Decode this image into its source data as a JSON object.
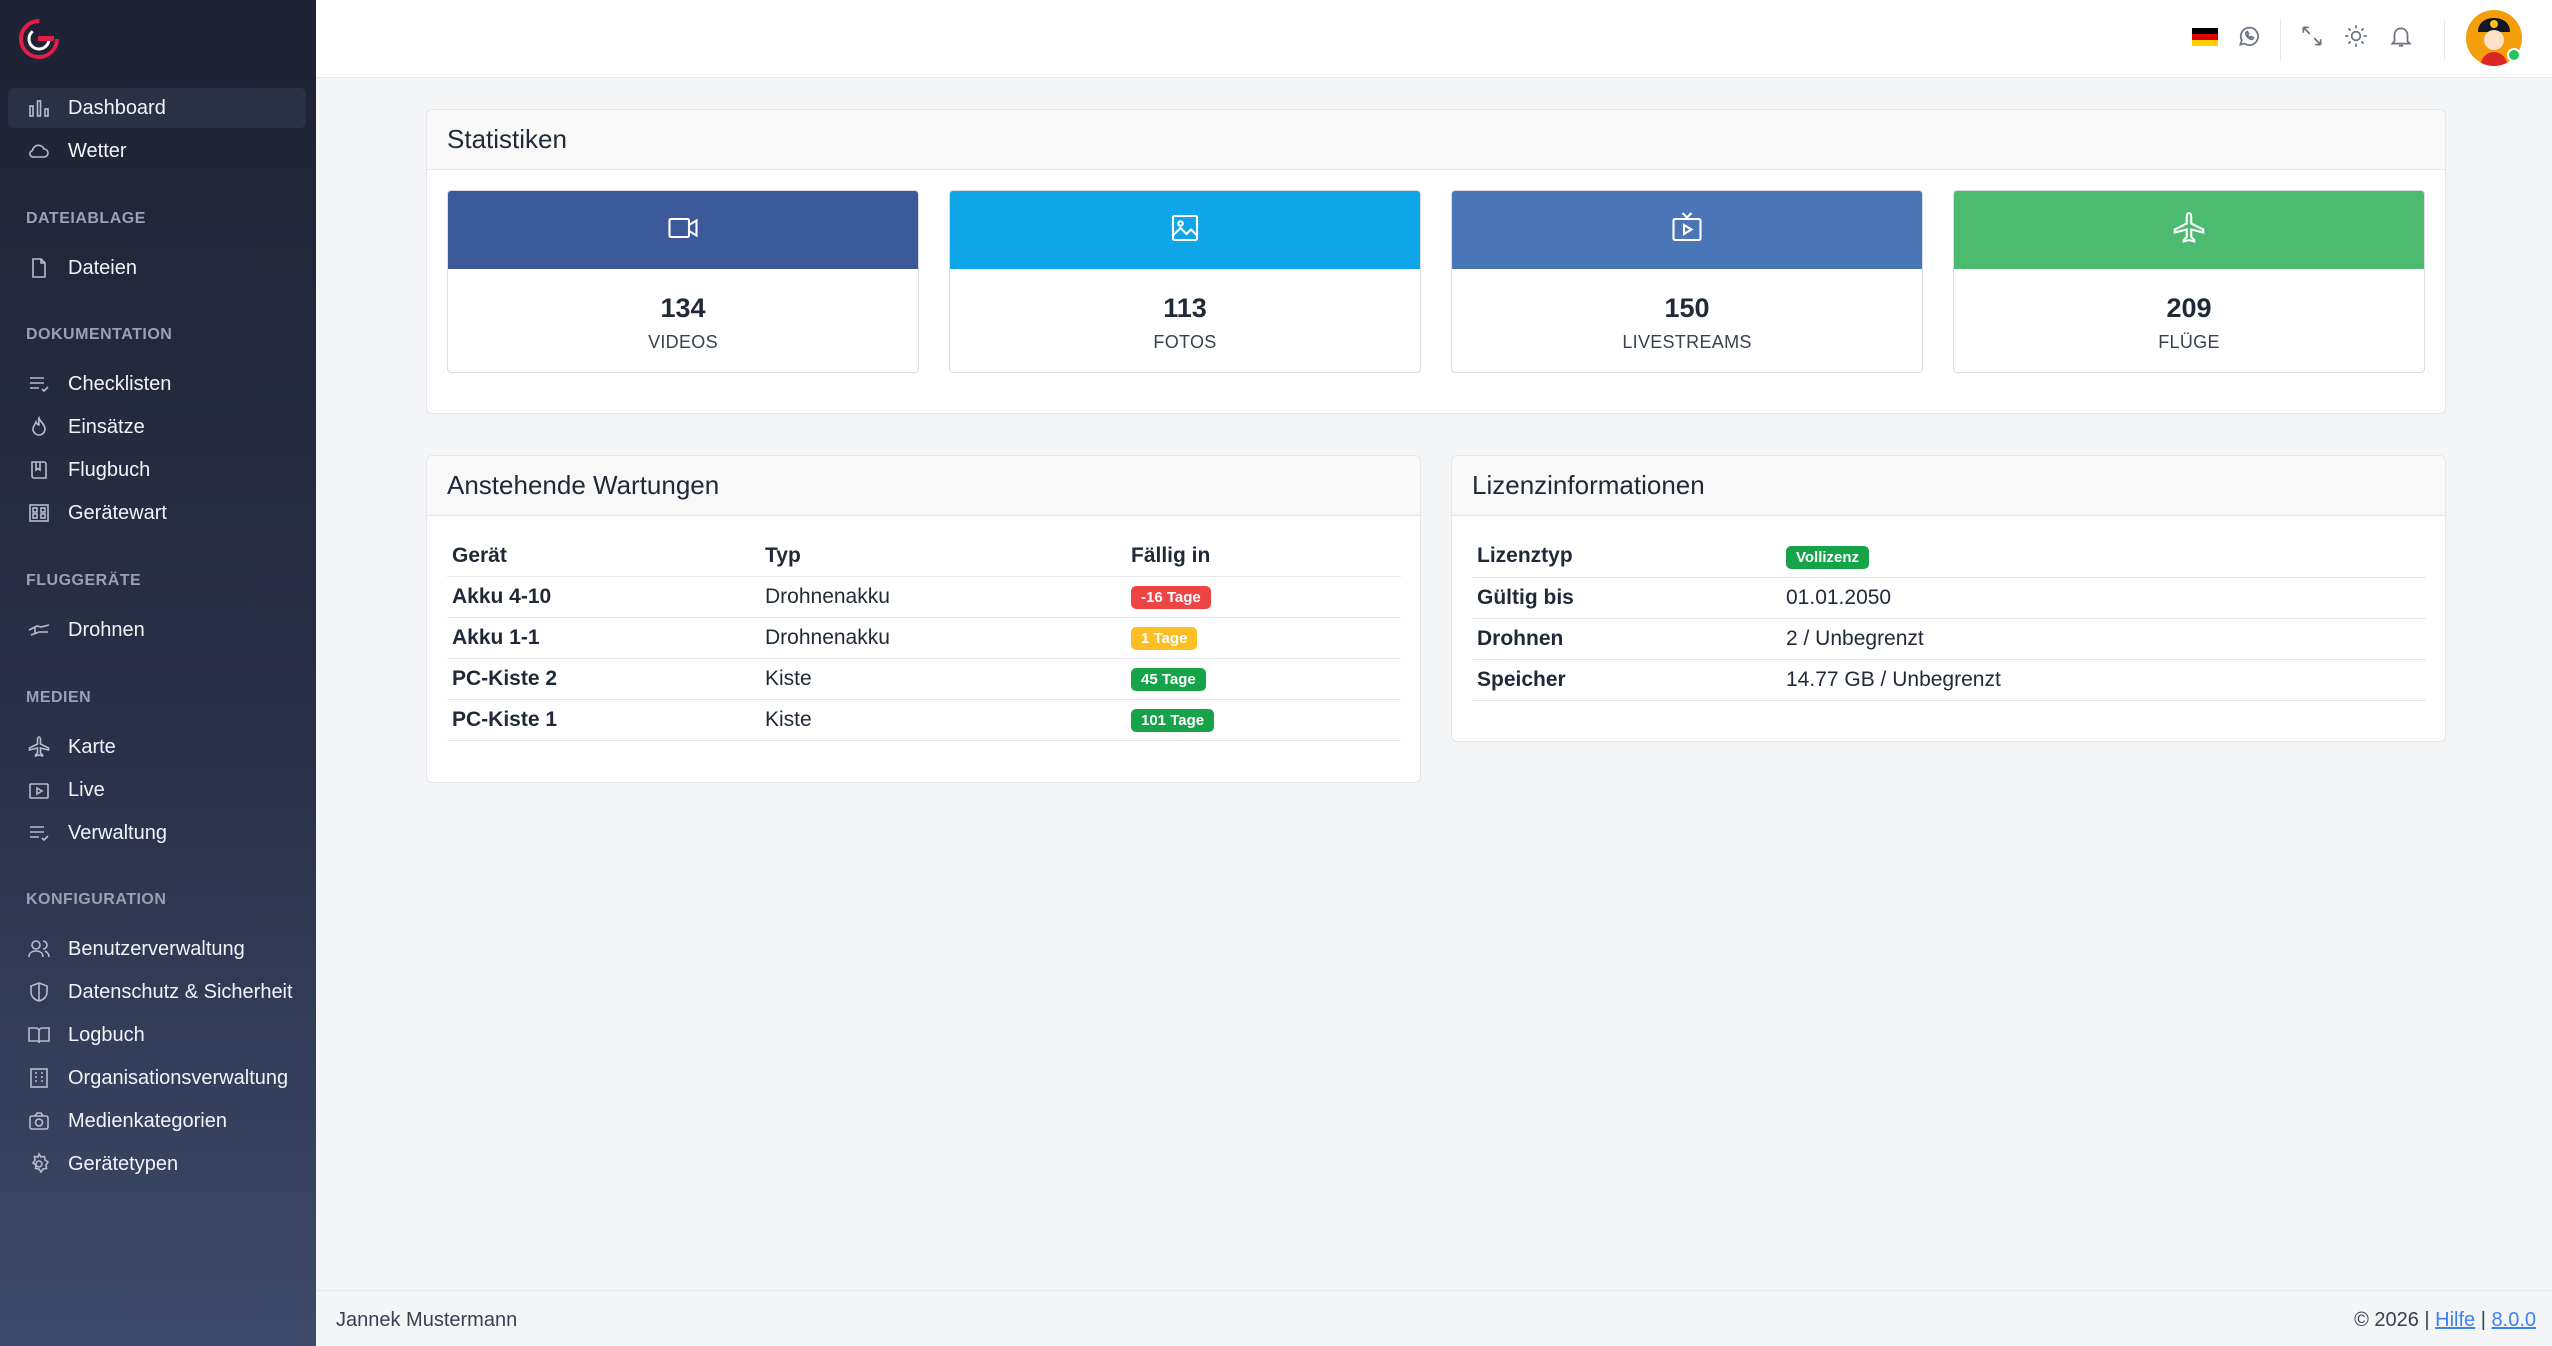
{
  "sidebar": {
    "items": {
      "dashboard": {
        "label": "Dashboard",
        "icon": "bar-chart-icon"
      },
      "wetter": {
        "label": "Wetter",
        "icon": "cloud-icon"
      },
      "dateien": {
        "label": "Dateien",
        "icon": "file-icon"
      },
      "checklisten": {
        "label": "Checklisten",
        "icon": "list-icon"
      },
      "einsaetze": {
        "label": "Einsätze",
        "icon": "flame-icon"
      },
      "flugbuch": {
        "label": "Flugbuch",
        "icon": "book-icon"
      },
      "geraetewart": {
        "label": "Gerätewart",
        "icon": "grid-icon"
      },
      "drohnen": {
        "label": "Drohnen",
        "icon": "drone-icon"
      },
      "karte": {
        "label": "Karte",
        "icon": "plane-icon"
      },
      "live": {
        "label": "Live",
        "icon": "live-tv-icon"
      },
      "verwaltung": {
        "label": "Verwaltung",
        "icon": "list-icon"
      },
      "benutzer": {
        "label": "Benutzerverwaltung",
        "icon": "users-icon"
      },
      "datenschutz": {
        "label": "Datenschutz & Sicherheit",
        "icon": "shield-icon"
      },
      "logbuch": {
        "label": "Logbuch",
        "icon": "open-book-icon"
      },
      "organisation": {
        "label": "Organisationsverwaltung",
        "icon": "building-icon"
      },
      "medienkategorien": {
        "label": "Medienkategorien",
        "icon": "camera-icon"
      },
      "geraetetypen": {
        "label": "Gerätetypen",
        "icon": "gear-icon"
      }
    },
    "sections": {
      "dateiablage": "DATEIABLAGE",
      "dokumentation": "DOKUMENTATION",
      "fluggeraete": "FLUGGERÄTE",
      "medien": "MEDIEN",
      "konfiguration": "KONFIGURATION"
    }
  },
  "statistiken": {
    "title": "Statistiken",
    "cards": [
      {
        "value": "134",
        "label": "VIDEOS",
        "color": "#3b5998",
        "icon": "video-camera-icon"
      },
      {
        "value": "113",
        "label": "FOTOS",
        "color": "#0ea5e9",
        "icon": "image-icon"
      },
      {
        "value": "150",
        "label": "LIVESTREAMS",
        "color": "#4a76b8",
        "icon": "live-tv-icon"
      },
      {
        "value": "209",
        "label": "FLÜGE",
        "color": "#4cbb70",
        "icon": "plane-icon"
      }
    ]
  },
  "wartungen": {
    "title": "Anstehende Wartungen",
    "headers": [
      "Gerät",
      "Typ",
      "Fällig in"
    ],
    "rows": [
      {
        "geraet": "Akku 4-10",
        "typ": "Drohnenakku",
        "faellig": "-16 Tage",
        "color": "#ef4444"
      },
      {
        "geraet": "Akku 1-1",
        "typ": "Drohnenakku",
        "faellig": "1 Tage",
        "color": "#fbbf24"
      },
      {
        "geraet": "PC-Kiste 2",
        "typ": "Kiste",
        "faellig": "45 Tage",
        "color": "#16a34a"
      },
      {
        "geraet": "PC-Kiste 1",
        "typ": "Kiste",
        "faellig": "101 Tage",
        "color": "#16a34a"
      }
    ]
  },
  "lizenz": {
    "title": "Lizenzinformationen",
    "rows": [
      {
        "label": "Lizenztyp",
        "value": "Vollizenz",
        "badge": true,
        "color": "#16a34a"
      },
      {
        "label": "Gültig bis",
        "value": "01.01.2050"
      },
      {
        "label": "Drohnen",
        "value": "2 / Unbegrenzt"
      },
      {
        "label": "Speicher",
        "value": "14.77 GB / Unbegrenzt"
      }
    ]
  },
  "footer": {
    "user": "Jannek Mustermann",
    "copyright": "© 2026 |",
    "help": "Hilfe",
    "separator": "|",
    "version": "8.0.0"
  }
}
